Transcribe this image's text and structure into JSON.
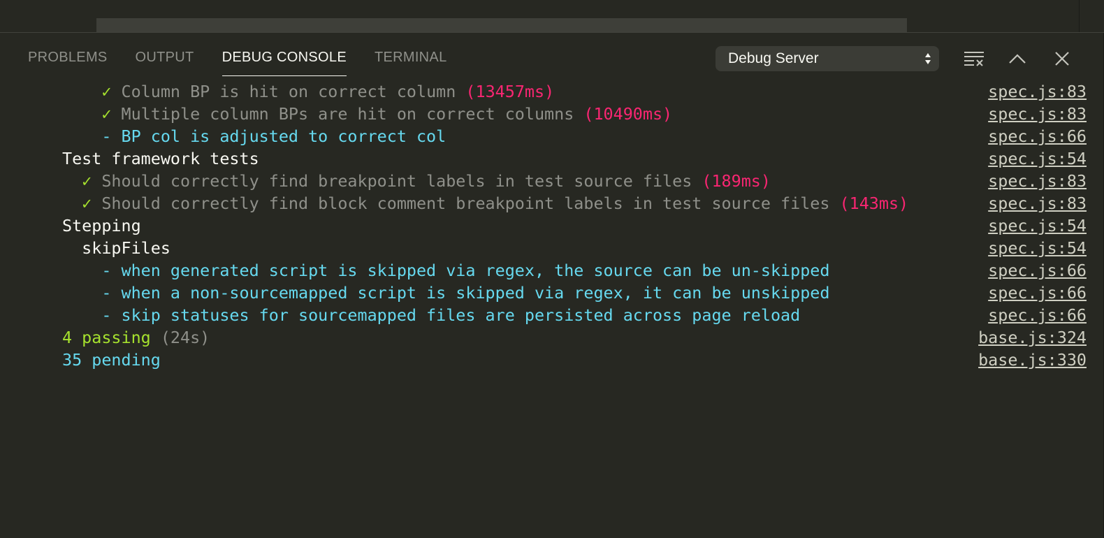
{
  "panel": {
    "tabs": [
      {
        "label": "PROBLEMS",
        "active": false
      },
      {
        "label": "OUTPUT",
        "active": false
      },
      {
        "label": "DEBUG CONSOLE",
        "active": true
      },
      {
        "label": "TERMINAL",
        "active": false
      }
    ],
    "session_select": {
      "value": "Debug Server"
    },
    "actions": [
      {
        "name": "clear-console-icon"
      },
      {
        "name": "maximize-panel-icon"
      },
      {
        "name": "close-panel-icon"
      }
    ]
  },
  "console": {
    "lines": [
      {
        "indent": "    ",
        "mark": "✓ ",
        "text": "Column BP is hit on correct column ",
        "time": "(13457ms)",
        "source": "spec.js:83",
        "kind": "pass"
      },
      {
        "indent": "    ",
        "mark": "✓ ",
        "text": "Multiple column BPs are hit on correct columns ",
        "time": "(10490ms)",
        "source": "spec.js:83",
        "kind": "pass"
      },
      {
        "indent": "    ",
        "mark": "",
        "text": "- BP col is adjusted to correct col",
        "time": "",
        "source": "spec.js:66",
        "kind": "pending"
      },
      {
        "indent": "",
        "mark": "",
        "text": "Test framework tests",
        "time": "",
        "source": "spec.js:54",
        "kind": "title"
      },
      {
        "indent": "  ",
        "mark": "✓ ",
        "text": "Should correctly find breakpoint labels in test source files ",
        "time": "(189ms)",
        "source": "spec.js:83",
        "kind": "pass"
      },
      {
        "indent": "  ",
        "mark": "✓ ",
        "text": "Should correctly find block comment breakpoint labels in test source files ",
        "time": "(143ms)",
        "source": "spec.js:83",
        "kind": "pass"
      },
      {
        "indent": "",
        "mark": "",
        "text": "Stepping",
        "time": "",
        "source": "spec.js:54",
        "kind": "title"
      },
      {
        "indent": "  ",
        "mark": "",
        "text": "skipFiles",
        "time": "",
        "source": "spec.js:54",
        "kind": "title"
      },
      {
        "indent": "    ",
        "mark": "",
        "text": "- when generated script is skipped via regex, the source can be un-skipped",
        "time": "",
        "source": "spec.js:66",
        "kind": "pending"
      },
      {
        "indent": "    ",
        "mark": "",
        "text": "- when a non-sourcemapped script is skipped via regex, it can be unskipped",
        "time": "",
        "source": "spec.js:66",
        "kind": "pending"
      },
      {
        "indent": "    ",
        "mark": "",
        "text": "- skip statuses for sourcemapped files are persisted across page reload",
        "time": "",
        "source": "spec.js:66",
        "kind": "pending"
      }
    ],
    "summary": {
      "passing": {
        "text": "4 passing",
        "duration": "(24s)",
        "source": "base.js:324"
      },
      "pending": {
        "text": "35 pending",
        "source": "base.js:330"
      }
    }
  },
  "colors": {
    "background": "#272822",
    "pass": "#a6e22e",
    "gray": "#8f908a",
    "time": "#f92672",
    "pending": "#66d9ef",
    "text": "#f8f8f2"
  }
}
